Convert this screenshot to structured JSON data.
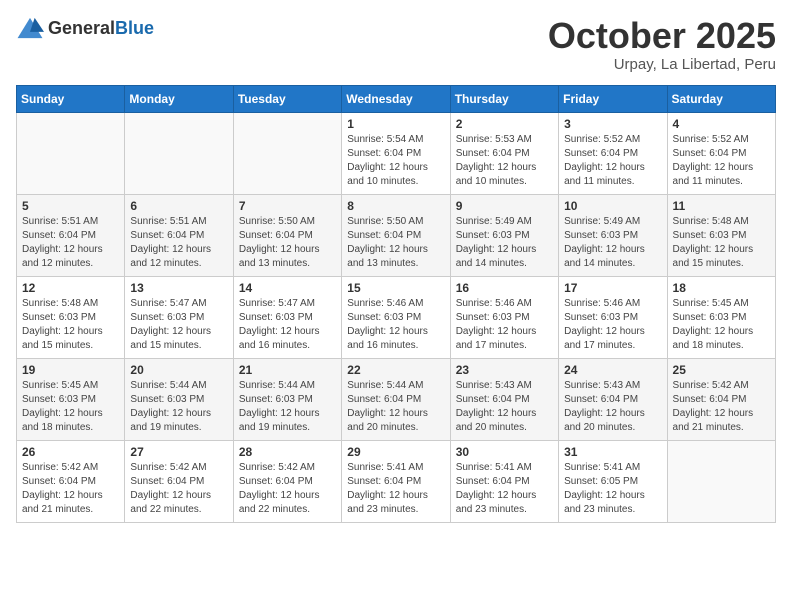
{
  "header": {
    "logo_general": "General",
    "logo_blue": "Blue",
    "month": "October 2025",
    "location": "Urpay, La Libertad, Peru"
  },
  "weekdays": [
    "Sunday",
    "Monday",
    "Tuesday",
    "Wednesday",
    "Thursday",
    "Friday",
    "Saturday"
  ],
  "weeks": [
    [
      {
        "day": "",
        "info": ""
      },
      {
        "day": "",
        "info": ""
      },
      {
        "day": "",
        "info": ""
      },
      {
        "day": "1",
        "info": "Sunrise: 5:54 AM\nSunset: 6:04 PM\nDaylight: 12 hours\nand 10 minutes."
      },
      {
        "day": "2",
        "info": "Sunrise: 5:53 AM\nSunset: 6:04 PM\nDaylight: 12 hours\nand 10 minutes."
      },
      {
        "day": "3",
        "info": "Sunrise: 5:52 AM\nSunset: 6:04 PM\nDaylight: 12 hours\nand 11 minutes."
      },
      {
        "day": "4",
        "info": "Sunrise: 5:52 AM\nSunset: 6:04 PM\nDaylight: 12 hours\nand 11 minutes."
      }
    ],
    [
      {
        "day": "5",
        "info": "Sunrise: 5:51 AM\nSunset: 6:04 PM\nDaylight: 12 hours\nand 12 minutes."
      },
      {
        "day": "6",
        "info": "Sunrise: 5:51 AM\nSunset: 6:04 PM\nDaylight: 12 hours\nand 12 minutes."
      },
      {
        "day": "7",
        "info": "Sunrise: 5:50 AM\nSunset: 6:04 PM\nDaylight: 12 hours\nand 13 minutes."
      },
      {
        "day": "8",
        "info": "Sunrise: 5:50 AM\nSunset: 6:04 PM\nDaylight: 12 hours\nand 13 minutes."
      },
      {
        "day": "9",
        "info": "Sunrise: 5:49 AM\nSunset: 6:03 PM\nDaylight: 12 hours\nand 14 minutes."
      },
      {
        "day": "10",
        "info": "Sunrise: 5:49 AM\nSunset: 6:03 PM\nDaylight: 12 hours\nand 14 minutes."
      },
      {
        "day": "11",
        "info": "Sunrise: 5:48 AM\nSunset: 6:03 PM\nDaylight: 12 hours\nand 15 minutes."
      }
    ],
    [
      {
        "day": "12",
        "info": "Sunrise: 5:48 AM\nSunset: 6:03 PM\nDaylight: 12 hours\nand 15 minutes."
      },
      {
        "day": "13",
        "info": "Sunrise: 5:47 AM\nSunset: 6:03 PM\nDaylight: 12 hours\nand 15 minutes."
      },
      {
        "day": "14",
        "info": "Sunrise: 5:47 AM\nSunset: 6:03 PM\nDaylight: 12 hours\nand 16 minutes."
      },
      {
        "day": "15",
        "info": "Sunrise: 5:46 AM\nSunset: 6:03 PM\nDaylight: 12 hours\nand 16 minutes."
      },
      {
        "day": "16",
        "info": "Sunrise: 5:46 AM\nSunset: 6:03 PM\nDaylight: 12 hours\nand 17 minutes."
      },
      {
        "day": "17",
        "info": "Sunrise: 5:46 AM\nSunset: 6:03 PM\nDaylight: 12 hours\nand 17 minutes."
      },
      {
        "day": "18",
        "info": "Sunrise: 5:45 AM\nSunset: 6:03 PM\nDaylight: 12 hours\nand 18 minutes."
      }
    ],
    [
      {
        "day": "19",
        "info": "Sunrise: 5:45 AM\nSunset: 6:03 PM\nDaylight: 12 hours\nand 18 minutes."
      },
      {
        "day": "20",
        "info": "Sunrise: 5:44 AM\nSunset: 6:03 PM\nDaylight: 12 hours\nand 19 minutes."
      },
      {
        "day": "21",
        "info": "Sunrise: 5:44 AM\nSunset: 6:03 PM\nDaylight: 12 hours\nand 19 minutes."
      },
      {
        "day": "22",
        "info": "Sunrise: 5:44 AM\nSunset: 6:04 PM\nDaylight: 12 hours\nand 20 minutes."
      },
      {
        "day": "23",
        "info": "Sunrise: 5:43 AM\nSunset: 6:04 PM\nDaylight: 12 hours\nand 20 minutes."
      },
      {
        "day": "24",
        "info": "Sunrise: 5:43 AM\nSunset: 6:04 PM\nDaylight: 12 hours\nand 20 minutes."
      },
      {
        "day": "25",
        "info": "Sunrise: 5:42 AM\nSunset: 6:04 PM\nDaylight: 12 hours\nand 21 minutes."
      }
    ],
    [
      {
        "day": "26",
        "info": "Sunrise: 5:42 AM\nSunset: 6:04 PM\nDaylight: 12 hours\nand 21 minutes."
      },
      {
        "day": "27",
        "info": "Sunrise: 5:42 AM\nSunset: 6:04 PM\nDaylight: 12 hours\nand 22 minutes."
      },
      {
        "day": "28",
        "info": "Sunrise: 5:42 AM\nSunset: 6:04 PM\nDaylight: 12 hours\nand 22 minutes."
      },
      {
        "day": "29",
        "info": "Sunrise: 5:41 AM\nSunset: 6:04 PM\nDaylight: 12 hours\nand 23 minutes."
      },
      {
        "day": "30",
        "info": "Sunrise: 5:41 AM\nSunset: 6:04 PM\nDaylight: 12 hours\nand 23 minutes."
      },
      {
        "day": "31",
        "info": "Sunrise: 5:41 AM\nSunset: 6:05 PM\nDaylight: 12 hours\nand 23 minutes."
      },
      {
        "day": "",
        "info": ""
      }
    ]
  ]
}
